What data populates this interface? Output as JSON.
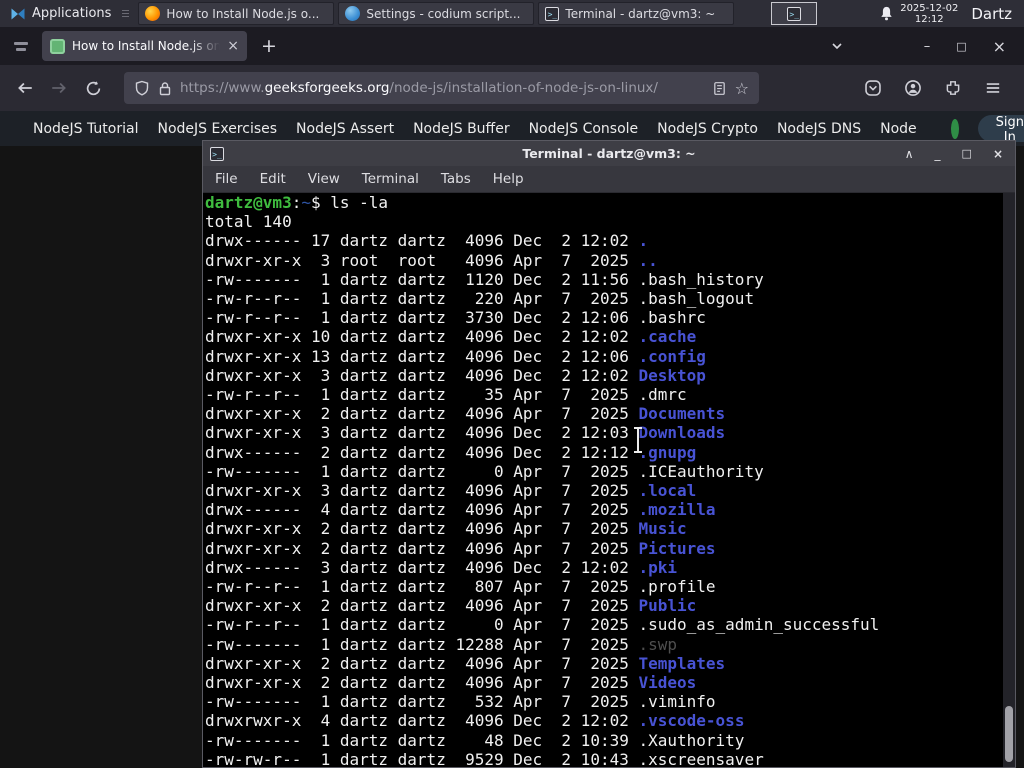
{
  "panel": {
    "applications_label": "Applications",
    "tasks": [
      {
        "icon": "firefox",
        "title": "How to Install Node.js o..."
      },
      {
        "icon": "vscodium",
        "title": "Settings - codium script..."
      },
      {
        "icon": "terminal",
        "title": "Terminal - dartz@vm3: ~"
      }
    ],
    "clock_date": "2025-12-02",
    "clock_time": "12:12",
    "user": "Dartz"
  },
  "browser": {
    "tab_title": "How to Install Node.js on",
    "url": {
      "scheme": "https://www.",
      "host": "geeksforgeeks.org",
      "path": "/node-js/installation-of-node-js-on-linux/"
    }
  },
  "site_nav": {
    "links": [
      "NodeJS Tutorial",
      "NodeJS Exercises",
      "NodeJS Assert",
      "NodeJS Buffer",
      "NodeJS Console",
      "NodeJS Crypto",
      "NodeJS DNS",
      "Node"
    ],
    "sign_in": "Sign In",
    "brand_color": "#2f8d46"
  },
  "terminal": {
    "window_title": "Terminal - dartz@vm3: ~",
    "menu": [
      "File",
      "Edit",
      "View",
      "Terminal",
      "Tabs",
      "Help"
    ],
    "colors": {
      "fg": "#f1f1f1",
      "green": "#3fbc3f",
      "navy": "#2f55a5",
      "blue": "#4853d4",
      "gray": "#4f4f4f"
    },
    "lines": [
      [
        {
          "t": "dartz@vm3",
          "c": "green"
        },
        {
          "t": ":",
          "c": "fg"
        },
        {
          "t": "~",
          "c": "navy"
        },
        {
          "t": "$ ls -la",
          "c": "fg"
        }
      ],
      [
        {
          "t": "total 140",
          "c": "fg"
        }
      ],
      [
        {
          "t": "drwx------ 17 dartz dartz  4096 Dec  2 12:02 ",
          "c": "fg"
        },
        {
          "t": ".",
          "c": "blue"
        }
      ],
      [
        {
          "t": "drwxr-xr-x  3 root  root   4096 Apr  7  2025 ",
          "c": "fg"
        },
        {
          "t": "..",
          "c": "blue"
        }
      ],
      [
        {
          "t": "-rw-------  1 dartz dartz  1120 Dec  2 11:56 .bash_history",
          "c": "fg"
        }
      ],
      [
        {
          "t": "-rw-r--r--  1 dartz dartz   220 Apr  7  2025 .bash_logout",
          "c": "fg"
        }
      ],
      [
        {
          "t": "-rw-r--r--  1 dartz dartz  3730 Dec  2 12:06 .bashrc",
          "c": "fg"
        }
      ],
      [
        {
          "t": "drwxr-xr-x 10 dartz dartz  4096 Dec  2 12:02 ",
          "c": "fg"
        },
        {
          "t": ".cache",
          "c": "blue"
        }
      ],
      [
        {
          "t": "drwxr-xr-x 13 dartz dartz  4096 Dec  2 12:06 ",
          "c": "fg"
        },
        {
          "t": ".config",
          "c": "blue"
        }
      ],
      [
        {
          "t": "drwxr-xr-x  3 dartz dartz  4096 Dec  2 12:02 ",
          "c": "fg"
        },
        {
          "t": "Desktop",
          "c": "blue"
        }
      ],
      [
        {
          "t": "-rw-r--r--  1 dartz dartz    35 Apr  7  2025 .dmrc",
          "c": "fg"
        }
      ],
      [
        {
          "t": "drwxr-xr-x  2 dartz dartz  4096 Apr  7  2025 ",
          "c": "fg"
        },
        {
          "t": "Documents",
          "c": "blue"
        }
      ],
      [
        {
          "t": "drwxr-xr-x  3 dartz dartz  4096 Dec  2 12:03 ",
          "c": "fg"
        },
        {
          "t": "Downloads",
          "c": "blue"
        }
      ],
      [
        {
          "t": "drwx------  2 dartz dartz  4096 Dec  2 12:12 ",
          "c": "fg"
        },
        {
          "t": ".gnupg",
          "c": "blue"
        }
      ],
      [
        {
          "t": "-rw-------  1 dartz dartz     0 Apr  7  2025 .ICEauthority",
          "c": "fg"
        }
      ],
      [
        {
          "t": "drwxr-xr-x  3 dartz dartz  4096 Apr  7  2025 ",
          "c": "fg"
        },
        {
          "t": ".local",
          "c": "blue"
        }
      ],
      [
        {
          "t": "drwx------  4 dartz dartz  4096 Apr  7  2025 ",
          "c": "fg"
        },
        {
          "t": ".mozilla",
          "c": "blue"
        }
      ],
      [
        {
          "t": "drwxr-xr-x  2 dartz dartz  4096 Apr  7  2025 ",
          "c": "fg"
        },
        {
          "t": "Music",
          "c": "blue"
        }
      ],
      [
        {
          "t": "drwxr-xr-x  2 dartz dartz  4096 Apr  7  2025 ",
          "c": "fg"
        },
        {
          "t": "Pictures",
          "c": "blue"
        }
      ],
      [
        {
          "t": "drwx------  3 dartz dartz  4096 Dec  2 12:02 ",
          "c": "fg"
        },
        {
          "t": ".pki",
          "c": "blue"
        }
      ],
      [
        {
          "t": "-rw-r--r--  1 dartz dartz   807 Apr  7  2025 .profile",
          "c": "fg"
        }
      ],
      [
        {
          "t": "drwxr-xr-x  2 dartz dartz  4096 Apr  7  2025 ",
          "c": "fg"
        },
        {
          "t": "Public",
          "c": "blue"
        }
      ],
      [
        {
          "t": "-rw-r--r--  1 dartz dartz     0 Apr  7  2025 .sudo_as_admin_successful",
          "c": "fg"
        }
      ],
      [
        {
          "t": "-rw-------  1 dartz dartz 12288 Apr  7  2025 ",
          "c": "fg"
        },
        {
          "t": ".swp",
          "c": "gray"
        }
      ],
      [
        {
          "t": "drwxr-xr-x  2 dartz dartz  4096 Apr  7  2025 ",
          "c": "fg"
        },
        {
          "t": "Templates",
          "c": "blue"
        }
      ],
      [
        {
          "t": "drwxr-xr-x  2 dartz dartz  4096 Apr  7  2025 ",
          "c": "fg"
        },
        {
          "t": "Videos",
          "c": "blue"
        }
      ],
      [
        {
          "t": "-rw-------  1 dartz dartz   532 Apr  7  2025 .viminfo",
          "c": "fg"
        }
      ],
      [
        {
          "t": "drwxrwxr-x  4 dartz dartz  4096 Dec  2 12:02 ",
          "c": "fg"
        },
        {
          "t": ".vscode-oss",
          "c": "blue"
        }
      ],
      [
        {
          "t": "-rw-------  1 dartz dartz    48 Dec  2 10:39 .Xauthority",
          "c": "fg"
        }
      ],
      [
        {
          "t": "-rw-rw-r--  1 dartz dartz  9529 Dec  2 10:43 .xscreensaver",
          "c": "fg"
        }
      ]
    ]
  }
}
